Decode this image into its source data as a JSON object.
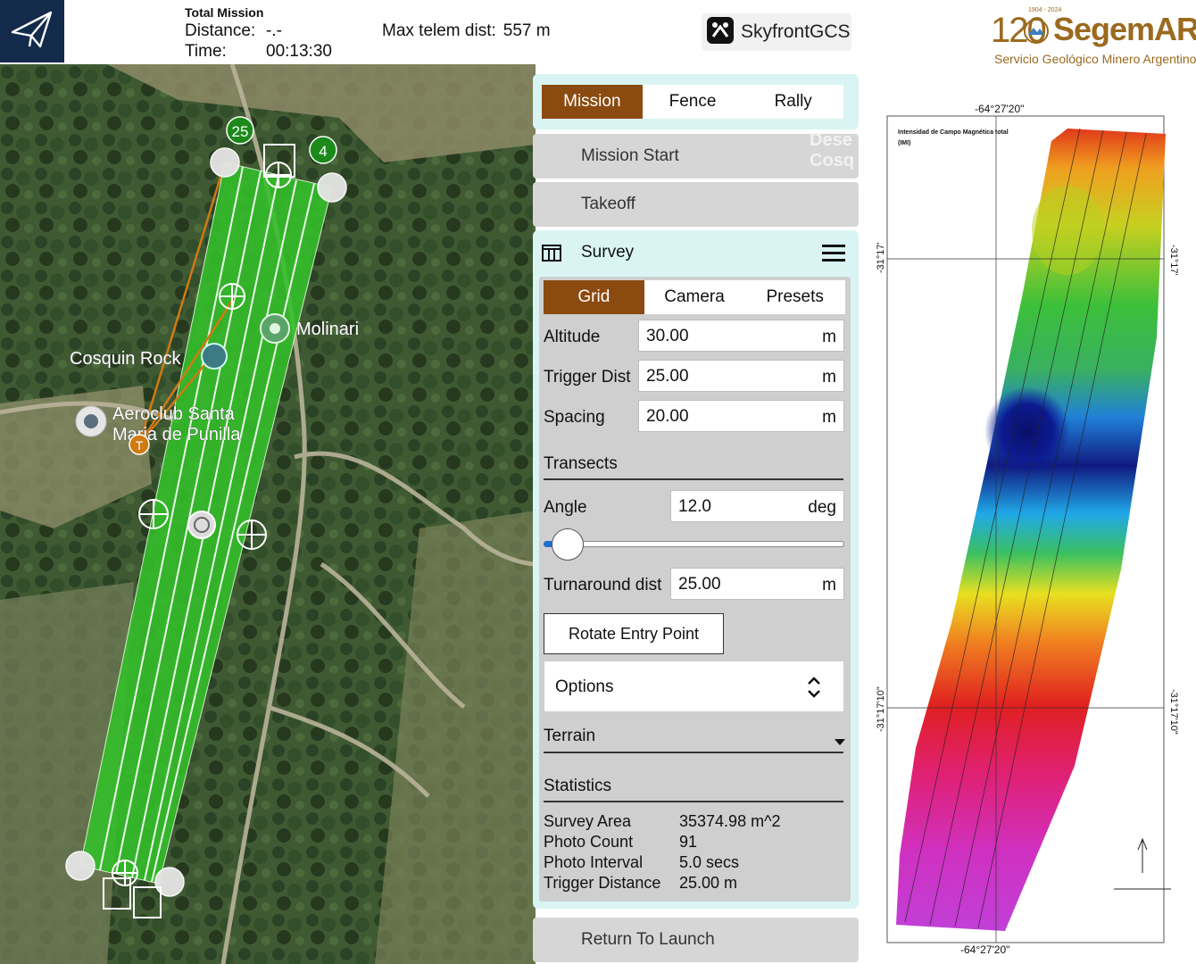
{
  "topbar": {
    "total_mission": "Total Mission",
    "distance_label": "Distance:",
    "distance_value": "-.-",
    "time_label": "Time:",
    "time_value": "00:13:30",
    "max_telem_label": "Max telem dist:",
    "max_telem_value": "557 m",
    "brand": "SkyfrontGCS"
  },
  "map": {
    "labels": [
      "Cosquin Rock",
      "Molinari",
      "Aeroclub Santa",
      "Maria de Punilla"
    ],
    "waypoint_start": "25",
    "waypoint_end": "4",
    "takeoff_marker": "T"
  },
  "plan_tabs": [
    "Mission",
    "Fence",
    "Rally"
  ],
  "items": {
    "mission_start": "Mission Start",
    "takeoff": "Takeoff",
    "return_to_launch": "Return To Launch",
    "watermark_line1": "Dese",
    "watermark_line2": "Cosq"
  },
  "survey": {
    "title": "Survey",
    "tabs": [
      "Grid",
      "Camera",
      "Presets"
    ],
    "altitude": {
      "label": "Altitude",
      "value": "30.00",
      "unit": "m"
    },
    "trigger_dist": {
      "label": "Trigger Dist",
      "value": "25.00",
      "unit": "m"
    },
    "spacing": {
      "label": "Spacing",
      "value": "20.00",
      "unit": "m"
    },
    "transects_header": "Transects",
    "angle": {
      "label": "Angle",
      "value": "12.0",
      "unit": "deg"
    },
    "angle_slider_fraction": 0.03,
    "turnaround": {
      "label": "Turnaround dist",
      "value": "25.00",
      "unit": "m"
    },
    "rotate_button": "Rotate Entry Point",
    "options": "Options",
    "terrain": "Terrain",
    "statistics_header": "Statistics",
    "stats": [
      {
        "label": "Survey Area",
        "value": "35374.98 m^2"
      },
      {
        "label": "Photo Count",
        "value": "91"
      },
      {
        "label": "Photo Interval",
        "value": "5.0 secs"
      },
      {
        "label": "Trigger Distance",
        "value": "25.00 m"
      }
    ]
  },
  "segemar": {
    "years": "1904 - 2024",
    "number": "120",
    "name": "SegemAR",
    "subtitle": "Servicio Geológico Minero Argentino"
  },
  "magnetic_map": {
    "title_line1": "Intensidad de Campo Magnética total",
    "title_line2": "(IMI)",
    "lon_top": "-64°27'20\"",
    "lon_bottom": "-64°27'20\"",
    "lat_1": "-31°17'",
    "lat_2": "-31°17'10\""
  },
  "colors": {
    "mission_tab": "#8b4a0f",
    "panel_bg": "#d9f4f3",
    "survey_polygon": "#34c12a",
    "waypoint_green": "#1b8a1b",
    "takeoff_orange": "#d07a12",
    "brand_navy": "#132a4a",
    "segemar_brown": "#9a6a1e"
  }
}
